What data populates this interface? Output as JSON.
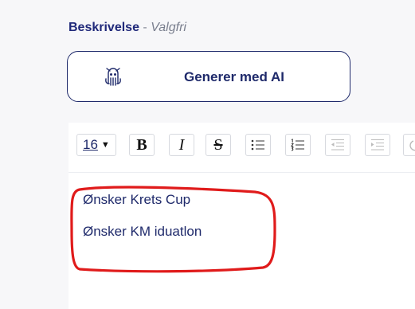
{
  "field": {
    "label": "Beskrivelse",
    "separator": " - ",
    "optional": "Valgfri"
  },
  "ai_button": {
    "label": "Generer med AI",
    "icon": "robot-icon"
  },
  "toolbar": {
    "font_size": "16",
    "bold": "B",
    "italic": "I",
    "strike": "S",
    "icons": [
      "bullet-list-icon",
      "numbered-list-icon",
      "outdent-icon",
      "indent-icon",
      "undo-icon"
    ]
  },
  "editor": {
    "lines": [
      "Ønsker Krets Cup",
      "Ønsker KM iduatlon"
    ]
  },
  "annotation": {
    "color": "#e01b1b"
  },
  "colors": {
    "primary": "#1f2a6b",
    "background": "#f7f7f9"
  }
}
